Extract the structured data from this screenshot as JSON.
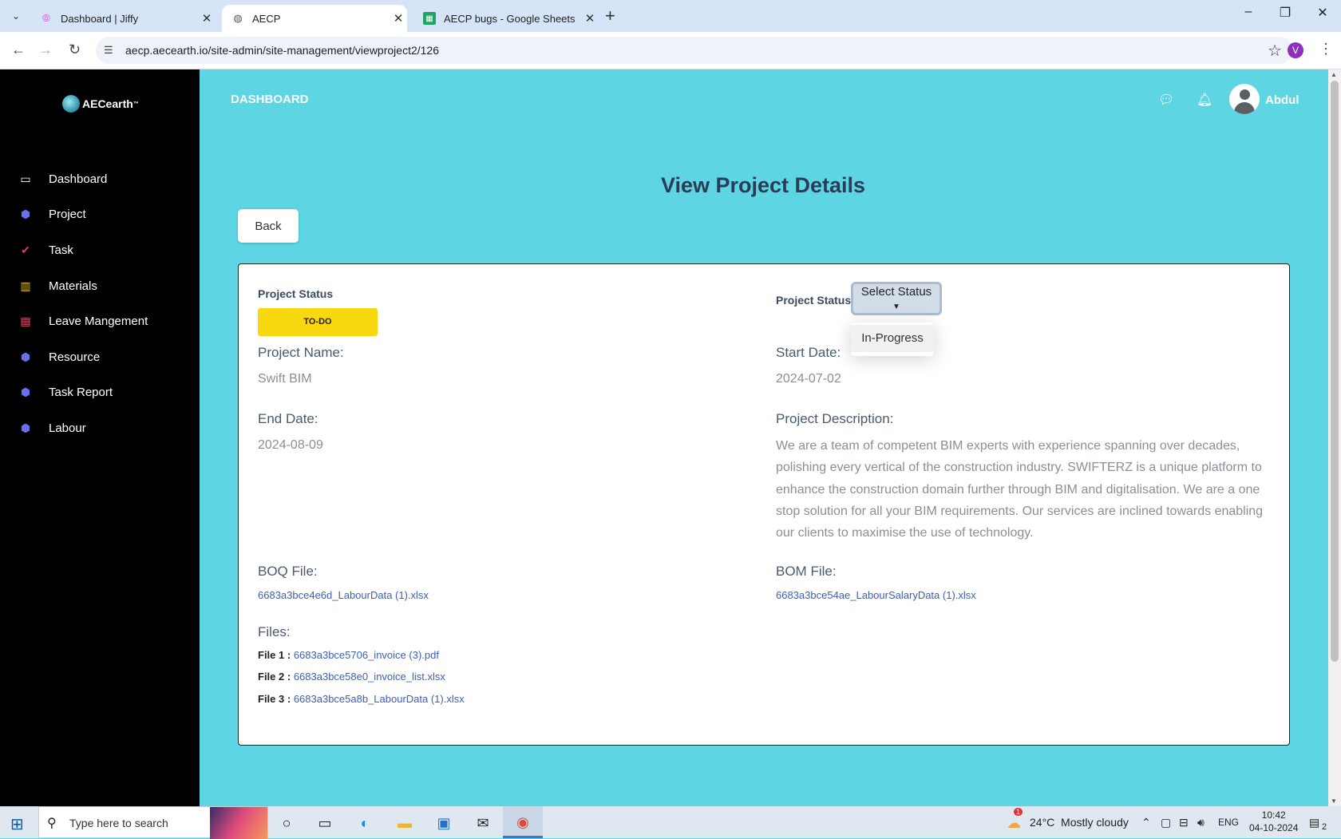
{
  "browser": {
    "tabs": [
      {
        "title": "Dashboard | Jiffy",
        "icon": "fingerprint-icon"
      },
      {
        "title": "AECP",
        "icon": "globe-icon"
      },
      {
        "title": "AECP bugs - Google Sheets",
        "icon": "sheets-icon"
      }
    ],
    "url": "aecp.aecearth.io/site-admin/site-management/viewproject2/126",
    "profile_initial": "V"
  },
  "sidebar": {
    "logo_text": "AECearth",
    "logo_tm": "™",
    "items": [
      {
        "label": "Dashboard",
        "icon": "monitor-icon",
        "color": "#ffffff"
      },
      {
        "label": "Project",
        "icon": "cube-icon",
        "color": "#6b6ef0"
      },
      {
        "label": "Task",
        "icon": "check-icon",
        "color": "#e8394d"
      },
      {
        "label": "Materials",
        "icon": "building-icon",
        "color": "#f3c41a"
      },
      {
        "label": "Leave Mangement",
        "icon": "calendar-icon",
        "color": "#f05a7e"
      },
      {
        "label": "Resource",
        "icon": "cube-icon",
        "color": "#6b6ef0"
      },
      {
        "label": "Task Report",
        "icon": "cube-icon",
        "color": "#6b6ef0"
      },
      {
        "label": "Labour",
        "icon": "cube-icon",
        "color": "#6b6ef0"
      }
    ]
  },
  "header": {
    "title": "DASHBOARD",
    "username": "Abdul"
  },
  "page": {
    "title": "View Project Details",
    "back_label": "Back"
  },
  "project": {
    "status_label": "Project Status",
    "status_badge": "TO-DO",
    "status_select_label": "Project Status",
    "select_button": "Select Status",
    "dropdown_options": [
      "In-Progress"
    ],
    "name_label": "Project Name:",
    "name": "Swift BIM",
    "start_label": "Start Date:",
    "start_date": "2024-07-02",
    "end_label": "End Date:",
    "end_date": "2024-08-09",
    "desc_label": "Project Description:",
    "description": "We are a team of competent BIM experts with experience spanning over decades, polishing every vertical of the construction industry. SWIFTERZ is a unique platform to enhance the construction domain further through BIM and digitalisation. We are a one stop solution for all your BIM requirements. Our services are inclined towards enabling our clients to maximise the use of technology.",
    "boq_label": "BOQ File:",
    "boq_file": "6683a3bce4e6d_LabourData (1).xlsx",
    "bom_label": "BOM File:",
    "bom_file": "6683a3bce54ae_LabourSalaryData (1).xlsx",
    "files_label": "Files:",
    "files": [
      {
        "label": "File 1 :",
        "name": "6683a3bce5706_invoice (3).pdf"
      },
      {
        "label": "File 2 :",
        "name": "6683a3bce58e0_invoice_list.xlsx"
      },
      {
        "label": "File 3 :",
        "name": "6683a3bce5a8b_LabourData (1).xlsx"
      }
    ]
  },
  "taskbar": {
    "search_placeholder": "Type here to search",
    "weather": "24°C  Mostly cloudy",
    "weather_badge": "1",
    "language": "ENG",
    "time": "10:42",
    "date": "04-10-2024",
    "notification_count": "2"
  }
}
